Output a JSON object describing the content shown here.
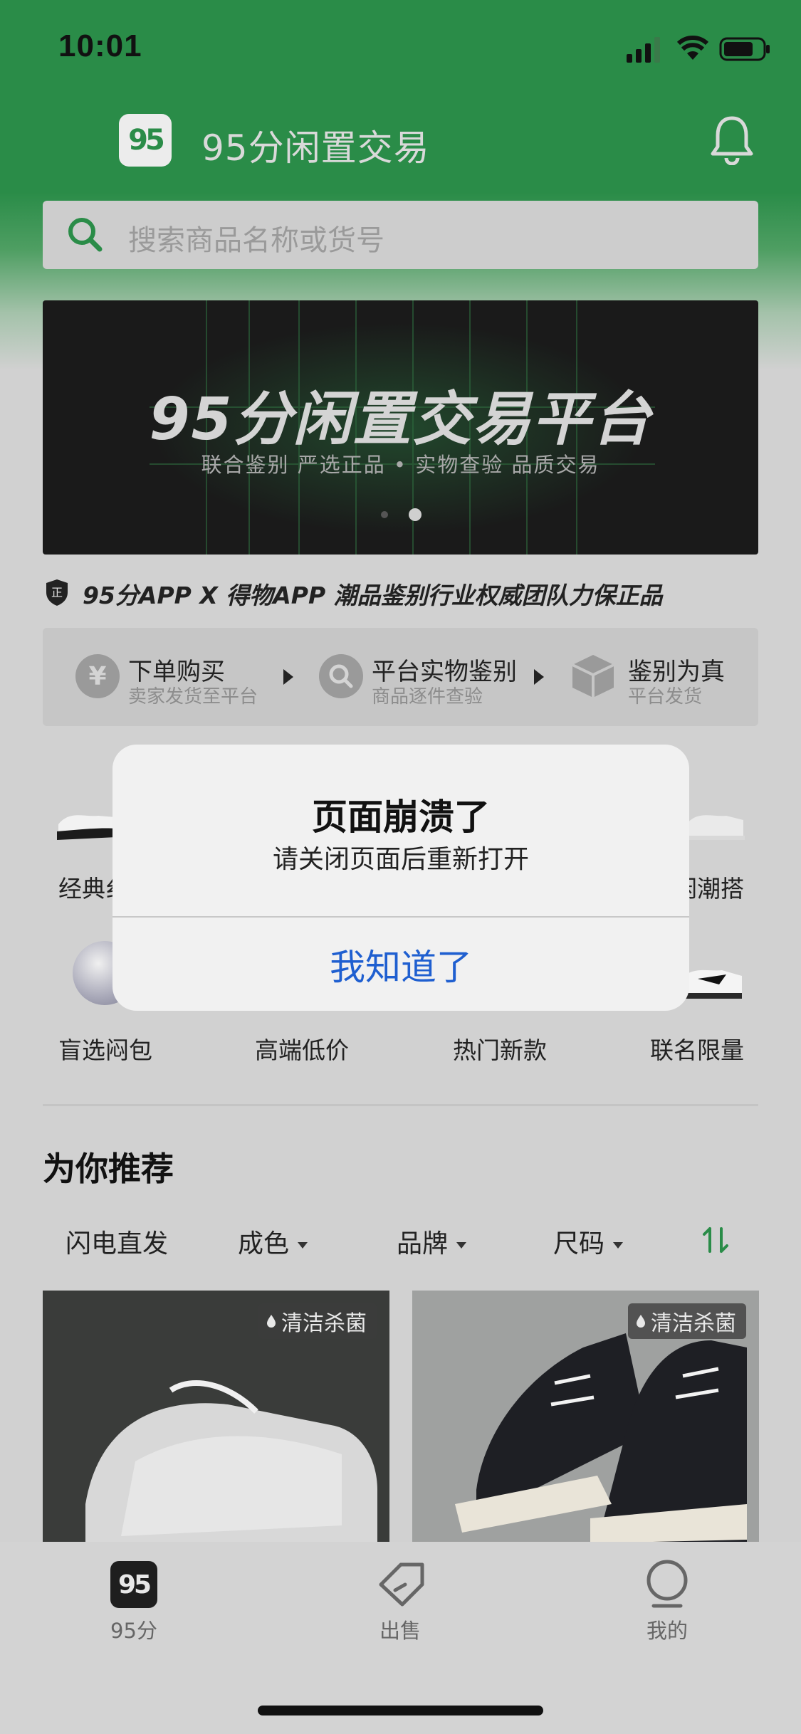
{
  "status_bar": {
    "time": "10:01"
  },
  "header": {
    "logo_text": "95",
    "title": "95分闲置交易",
    "bell_icon": "bell-icon"
  },
  "search": {
    "placeholder": "搜索商品名称或货号"
  },
  "banner": {
    "title": "95分闲置交易平台",
    "subtitle": "联合鉴别 严选正品 • 实物查验 品质交易",
    "active_dot": 2,
    "dot_count": 2
  },
  "auth_line": {
    "text": "95分APP X 得物APP 潮品鉴别行业权威团队力保正品"
  },
  "steps": [
    {
      "icon": "¥",
      "title": "下单购买",
      "sub": "卖家发货至平台"
    },
    {
      "icon": "search",
      "title": "平台实物鉴别",
      "sub": "商品逐件查验"
    },
    {
      "icon": "box",
      "title": "鉴别为真",
      "sub": "平台发货"
    }
  ],
  "categories_row1": [
    {
      "label": "经典纟"
    },
    {
      "label": "闲潮搭"
    }
  ],
  "categories_row2": [
    {
      "label": "盲选闷包"
    },
    {
      "label": "高端低价"
    },
    {
      "label": "热门新款"
    },
    {
      "label": "联名限量"
    }
  ],
  "recommend": {
    "title": "为你推荐",
    "filters": [
      {
        "label": "闪电直发",
        "dropdown": false
      },
      {
        "label": "成色",
        "dropdown": true
      },
      {
        "label": "品牌",
        "dropdown": true
      },
      {
        "label": "尺码",
        "dropdown": true
      }
    ]
  },
  "products": [
    {
      "badge": "清洁杀菌"
    },
    {
      "badge": "清洁杀菌"
    }
  ],
  "tabbar": [
    {
      "label": "95分",
      "icon": "logo-icon"
    },
    {
      "label": "出售",
      "icon": "tag-icon"
    },
    {
      "label": "我的",
      "icon": "user-icon"
    }
  ],
  "modal": {
    "title": "页面崩溃了",
    "message": "请关闭页面后重新打开",
    "button": "我知道了"
  },
  "colors": {
    "brand_green": "#2a8c48",
    "alert_button": "#1f5fd0"
  }
}
